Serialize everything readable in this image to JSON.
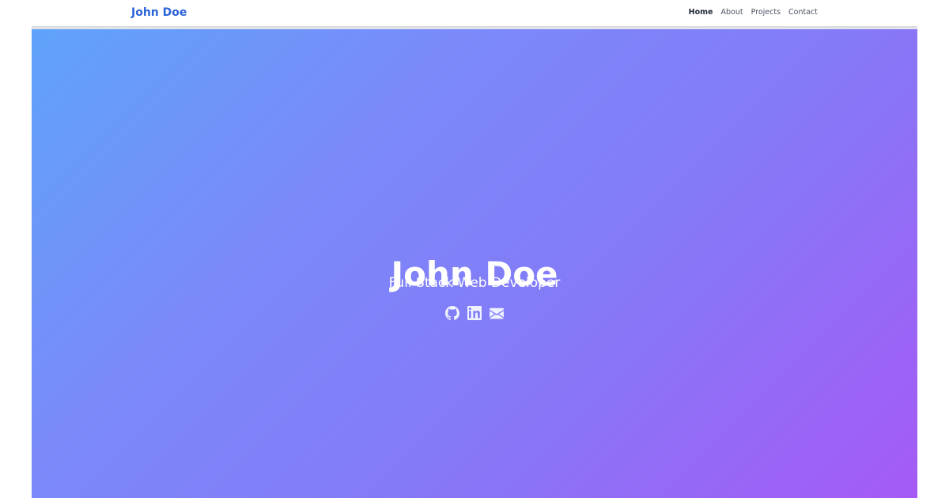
{
  "navbar": {
    "brand": "John Doe",
    "links": [
      {
        "label": "Home",
        "active": true
      },
      {
        "label": "About",
        "active": false
      },
      {
        "label": "Projects",
        "active": false
      },
      {
        "label": "Contact",
        "active": false
      }
    ]
  },
  "hero": {
    "title": "John Doe",
    "subtitle": "Full Stack Web Developer",
    "social_icons": [
      "github-icon",
      "linkedin-icon",
      "email-icon"
    ]
  },
  "colors": {
    "brand": "#2b63d9",
    "gradient_start": "#5fa3fb",
    "gradient_mid": "#8579f7",
    "gradient_end": "#a55af5",
    "hero_text": "#ffffff"
  }
}
